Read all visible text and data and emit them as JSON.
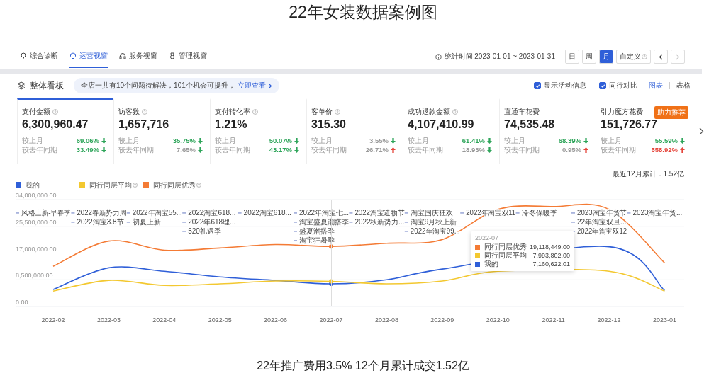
{
  "title": "22年女装数据案例图",
  "nav": {
    "tabs": [
      {
        "label": "综合诊断",
        "selected": false
      },
      {
        "label": "运营视窗",
        "selected": true
      },
      {
        "label": "服务视窗",
        "selected": false
      },
      {
        "label": "管理视窗",
        "selected": false
      }
    ],
    "period_label": "统计时间 2023-01-01 ~ 2023-01-31",
    "ranges": [
      {
        "label": "日",
        "selected": false
      },
      {
        "label": "周",
        "selected": false
      },
      {
        "label": "月",
        "selected": true
      },
      {
        "label": "自定义",
        "selected": false
      }
    ],
    "prev": {
      "disabled": false
    },
    "next": {
      "disabled": true
    }
  },
  "board": {
    "title": "整体看板",
    "notice": "全店一共有10个问题待解决，101个机会可提升，",
    "notice_link": "立即查看",
    "options": [
      {
        "label": "显示活动信息",
        "checked": true
      },
      {
        "label": "同行对比",
        "checked": true
      }
    ],
    "views": [
      {
        "label": "图表",
        "selected": true
      },
      {
        "label": "表格",
        "selected": false
      }
    ]
  },
  "kpis": [
    {
      "name": "支付金额",
      "help": true,
      "value": "6,300,960.47",
      "selected": true,
      "compare": [
        {
          "label": "较上月",
          "pct": "69.06%",
          "color": "#2ea55a",
          "kind": "down"
        },
        {
          "label": "较去年同期",
          "pct": "33.49%",
          "color": "#2ea55a",
          "kind": "down"
        }
      ]
    },
    {
      "name": "访客数",
      "help": true,
      "value": "1,657,716",
      "selected": false,
      "compare": [
        {
          "label": "较上月",
          "pct": "35.75%",
          "color": "#2ea55a",
          "kind": "down"
        },
        {
          "label": "较去年同期",
          "pct": "7.65%",
          "color": "#999999",
          "kind": "down"
        }
      ]
    },
    {
      "name": "支付转化率",
      "help": true,
      "value": "1.21%",
      "selected": false,
      "compare": [
        {
          "label": "较上月",
          "pct": "50.07%",
          "color": "#2ea55a",
          "kind": "down"
        },
        {
          "label": "较去年同期",
          "pct": "43.17%",
          "color": "#2ea55a",
          "kind": "down"
        }
      ]
    },
    {
      "name": "客单价",
      "help": true,
      "value": "315.30",
      "selected": false,
      "compare": [
        {
          "label": "较上月",
          "pct": "3.55%",
          "color": "#999999",
          "kind": "down"
        },
        {
          "label": "较去年同期",
          "pct": "26.71%",
          "color": "#999999",
          "kind": "up"
        }
      ]
    },
    {
      "name": "成功退款金额",
      "help": true,
      "value": "4,107,410.99",
      "selected": false,
      "compare": [
        {
          "label": "较上月",
          "pct": "61.41%",
          "color": "#2ea55a",
          "kind": "down"
        },
        {
          "label": "较去年同期",
          "pct": "18.93%",
          "color": "#999999",
          "kind": "down"
        }
      ]
    },
    {
      "name": "直通车花费",
      "help": false,
      "value": "74,535.48",
      "selected": false,
      "compare": [
        {
          "label": "较上月",
          "pct": "68.39%",
          "color": "#2ea55a",
          "kind": "down"
        },
        {
          "label": "较去年同期",
          "pct": "0.95%",
          "color": "#999999",
          "kind": "up"
        }
      ]
    },
    {
      "name": "引力魔方花费",
      "help": false,
      "value": "151,726.77",
      "selected": false,
      "badge": "助力推荐",
      "compare": [
        {
          "label": "较上月",
          "pct": "55.59%",
          "color": "#2ea55a",
          "kind": "down"
        },
        {
          "label": "较去年同期",
          "pct": "558.92%",
          "color": "#e5453b",
          "kind": "up"
        }
      ]
    }
  ],
  "chart": {
    "total": "最近12月累计：1.52亿",
    "legend_help": [
      false,
      true,
      true
    ],
    "chart_data": {
      "type": "line",
      "grid": true,
      "legend": "top",
      "categories": [
        "2022-02",
        "2022-03",
        "2022-04",
        "2022-05",
        "2022-06",
        "2022-07",
        "2022-08",
        "2022-09",
        "2022-10",
        "2022-11",
        "2022-12",
        "2023-01"
      ],
      "ylim": [
        0,
        34000000
      ],
      "yticks": [
        {
          "value": 0,
          "label": "0.00"
        },
        {
          "value": 8500000,
          "label": "8,500,000.00"
        },
        {
          "value": 17000000,
          "label": "17,000,000.00"
        },
        {
          "value": 25500000,
          "label": "25,500,000.00"
        },
        {
          "value": 34000000,
          "label": "34,000,000.00"
        }
      ],
      "series": [
        {
          "name": "我的",
          "color": "#2f5fd8",
          "values": [
            5400000,
            12300000,
            11200000,
            9400000,
            8300000,
            7200000,
            8500000,
            11900000,
            null,
            null,
            19000000,
            5100000
          ]
        },
        {
          "name": "同行同层平均",
          "color": "#f3c830",
          "values": [
            4900000,
            8300000,
            6700000,
            7200000,
            8100000,
            8000000,
            7200000,
            8100000,
            11200000,
            null,
            11200000,
            4900000
          ]
        },
        {
          "name": "同行同层优秀",
          "color": "#f47b35",
          "values": [
            12800000,
            20800000,
            17900000,
            18600000,
            19700000,
            19100000,
            20100000,
            21300000,
            30900000,
            31800000,
            30900000,
            13900000
          ]
        }
      ]
    },
    "activity_columns": [
      [
        "风格上新-早春季"
      ],
      [
        "2022春新势力周",
        "2022淘宝3.8节"
      ],
      [
        "2022年淘宝55...",
        "初夏上新"
      ],
      [
        "2022淘宝618...",
        "2022年618理...",
        "520礼遇季"
      ],
      [
        "2022淘宝618..."
      ],
      [
        "2022年淘宝七...",
        "淘宝盛夏潮搭季",
        "盛夏潮搭季",
        "淘宝狂暑季"
      ],
      [
        "2022淘宝造物节",
        "2022秋新势力..."
      ],
      [
        "淘宝国庆狂欢",
        "淘宝9月秋上新",
        "2022年淘宝99..."
      ],
      [
        "2022年淘宝双11"
      ],
      [
        "冷冬保暖季"
      ],
      [
        "2023淘宝年货节",
        "22年淘宝双旦...",
        "2022年淘宝双12"
      ],
      [
        "2023淘宝年货..."
      ]
    ],
    "tooltip": {
      "title": "2022-07",
      "rows": [
        {
          "name": "同行同层优秀",
          "value": "19,118,449.00"
        },
        {
          "name": "同行同层平均",
          "value": "7,993,802.00"
        },
        {
          "name": "我的",
          "value": "7,160,622.01"
        }
      ]
    }
  },
  "caption": "22年推广费用3.5% 12个月累计成交1.52亿"
}
